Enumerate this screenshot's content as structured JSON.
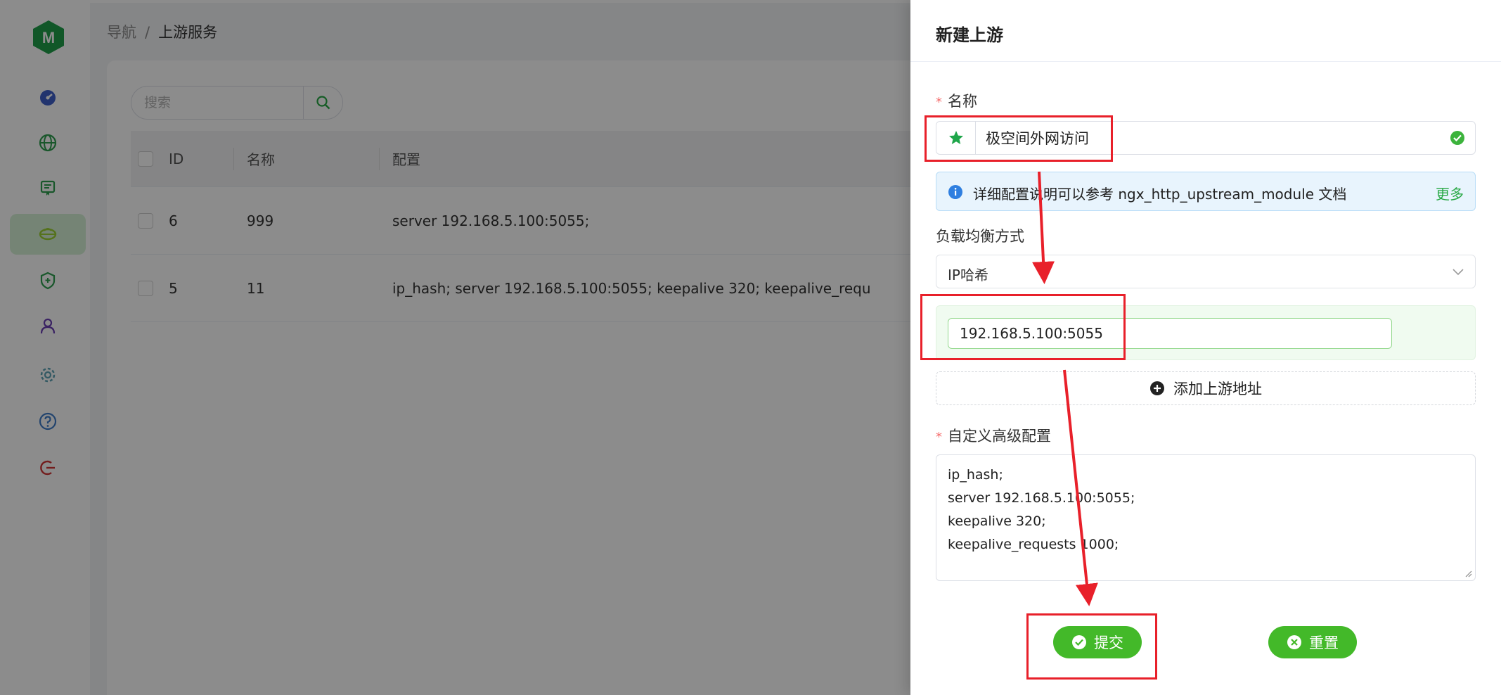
{
  "app": {
    "logo_letter": "M",
    "brand_color": "#1f9e4a"
  },
  "sidebar": {
    "items": [
      {
        "icon": "dashboard-icon",
        "color": "#3f5fc9"
      },
      {
        "icon": "globe-icon",
        "color": "#2e9f4f"
      },
      {
        "icon": "certificate-icon",
        "color": "#2e9f4f"
      },
      {
        "icon": "upstream-icon",
        "color": "#9bcf34",
        "active": true
      },
      {
        "icon": "shield-icon",
        "color": "#2e9f4f"
      },
      {
        "icon": "user-icon",
        "color": "#6b3fb5"
      },
      {
        "icon": "gear-icon",
        "color": "#5ea3b5"
      },
      {
        "icon": "help-icon",
        "color": "#3f7cc9"
      },
      {
        "icon": "logout-icon",
        "color": "#d23636"
      }
    ]
  },
  "breadcrumb": {
    "root": "导航",
    "separator": "/",
    "current": "上游服务"
  },
  "search": {
    "placeholder": "搜索"
  },
  "table": {
    "columns": [
      "ID",
      "名称",
      "配置"
    ],
    "rows": [
      {
        "id": "6",
        "name": "999",
        "config": "server 192.168.5.100:5055;"
      },
      {
        "id": "5",
        "name": "11",
        "config": "ip_hash; server 192.168.5.100:5055; keepalive 320; keepalive_requ"
      }
    ]
  },
  "drawer": {
    "title": "新建上游",
    "name_label": "名称",
    "name_value": "极空间外网访问",
    "alert_text": "详细配置说明可以参考 ngx_http_upstream_module 文档",
    "alert_more": "更多",
    "lb_label": "负载均衡方式",
    "lb_value": "IP哈希",
    "upstream_address": "192.168.5.100:5055",
    "add_upstream_label": "添加上游地址",
    "custom_label": "自定义高级配置",
    "custom_lines": [
      "ip_hash;",
      "server 192.168.5.100:5055;",
      "keepalive 320;",
      "keepalive_requests 1000;"
    ],
    "submit_label": "提交",
    "reset_label": "重置",
    "required_mark": "*"
  },
  "colors": {
    "accent": "#43b929",
    "annotation": "#e8202a",
    "required": "#f56c6c"
  }
}
